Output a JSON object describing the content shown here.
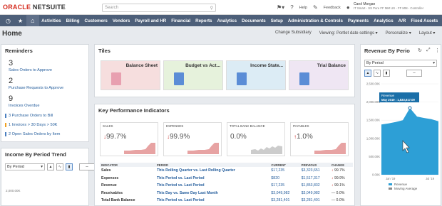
{
  "brand": {
    "part1": "ORACLE",
    "part2": "NETSUITE"
  },
  "search": {
    "placeholder": "Search"
  },
  "top_icons": {
    "help": "Help",
    "feedback": "Feedback"
  },
  "user": {
    "name": "Carol Morgan",
    "role": "IT Smart - SS Pure FF MM US - FF MM - Controller"
  },
  "nav": [
    "Activities",
    "Billing",
    "Customers",
    "Vendors",
    "Payroll and HR",
    "Financial",
    "Reports",
    "Analytics",
    "Documents",
    "Setup",
    "Administration & Controls",
    "Payments",
    "Analytics",
    "A/R",
    "Fixed Assets"
  ],
  "page": {
    "title": "Home",
    "change_subsidiary": "Change Subsidiary",
    "viewing": "Viewing: Portlet date settings",
    "personalize": "Personalize",
    "layout": "Layout"
  },
  "reminders": {
    "title": "Reminders",
    "items": [
      {
        "count": "3",
        "label": "Sales Orders to Approve"
      },
      {
        "count": "2",
        "label": "Purchase Requests to Approve"
      },
      {
        "count": "9",
        "label": "Invoices Overdue"
      }
    ],
    "links": [
      {
        "text": "3 Purchase Orders to Bill",
        "color": "#4a7fbf"
      },
      {
        "text": "1 Invoices > 30 Days > 50K",
        "color": "#f0a020"
      },
      {
        "text": "2 Open Sales Orders by Item",
        "color": "#4a7fbf"
      }
    ]
  },
  "income_trend": {
    "title": "Income By Period Trend",
    "select": "By Period",
    "axis_label": "2,000.00K"
  },
  "tiles": {
    "title": "Tiles",
    "items": [
      {
        "label": "Balance Sheet",
        "bg": "#f6dede",
        "icon": "#e8a0b0"
      },
      {
        "label": "Budget vs Act...",
        "bg": "#e6f2dc",
        "icon": "#5b8dd6"
      },
      {
        "label": "Income State...",
        "bg": "#dcecf5",
        "icon": "#5b8dd6"
      },
      {
        "label": "Trial Balance",
        "bg": "#efe6f3",
        "icon": "#5b8dd6"
      }
    ]
  },
  "kpi": {
    "title": "Key Performance Indicators",
    "cards": [
      {
        "label": "SALES",
        "value": "99.7%",
        "arrow": "↓",
        "dir": "down"
      },
      {
        "label": "EXPENSES",
        "value": "99.9%",
        "arrow": "↓",
        "dir": "down"
      },
      {
        "label": "TOTAL BANK BALANCE",
        "value": "0.0%",
        "arrow": "",
        "dir": "flat"
      },
      {
        "label": "PAYABLES",
        "value": "1.0%",
        "arrow": "↑",
        "dir": "down"
      }
    ],
    "headers": [
      "INDICATOR",
      "PERIOD",
      "CURRENT",
      "PREVIOUS",
      "CHANGE"
    ],
    "rows": [
      {
        "indicator": "Sales",
        "period": "This Rolling Quarter vs. Last Rolling Quarter",
        "current": "$17,235",
        "previous": "$3,323,651",
        "change": "99.7%",
        "dir": "down"
      },
      {
        "indicator": "Expenses",
        "period": "This Period vs. Last Period",
        "current": "$820",
        "previous": "$1,517,317",
        "change": "99.9%",
        "dir": "down"
      },
      {
        "indicator": "Revenue",
        "period": "This Period vs. Last Period",
        "current": "$17,235",
        "previous": "$1,853,832",
        "change": "99.1%",
        "dir": "down"
      },
      {
        "indicator": "Receivables",
        "period": "This Day vs. Same Day Last Month",
        "current": "$3,049,982",
        "previous": "$3,049,982",
        "change": "0.0%",
        "dir": "flat"
      },
      {
        "indicator": "Total Bank Balance",
        "period": "This Period vs. Last Period",
        "current": "$3,281,401",
        "previous": "$3,281,401",
        "change": "0.0%",
        "dir": "flat"
      }
    ]
  },
  "revenue": {
    "title": "Revenue By Perio",
    "select": "By Period",
    "tooltip_series": "Revenue",
    "tooltip_value": "May 2019 : 1,833,617.09",
    "legend": [
      "Revenue",
      "Moving Average"
    ],
    "chart_data": {
      "type": "area",
      "yticks": [
        "2,500.00K",
        "2,000.00K",
        "1,500.00K",
        "1,000.00K",
        "500.00K",
        "0.00K"
      ],
      "xticks": [
        "Jan '19",
        "Jul '19"
      ],
      "series": [
        {
          "name": "Revenue",
          "values": [
            1380,
            1410,
            1450,
            1500,
            1833.6,
            1600,
            1560,
            1530,
            1470
          ]
        }
      ]
    }
  }
}
